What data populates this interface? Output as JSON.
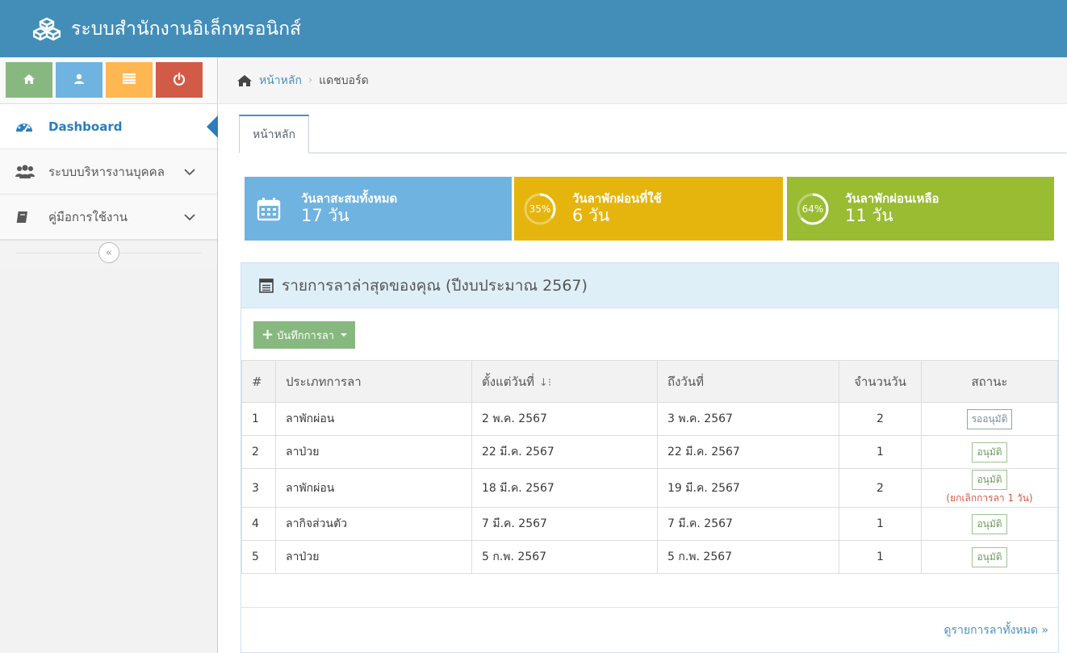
{
  "app": {
    "title": "ระบบสำนักงานอิเล็กทรอนิกส์"
  },
  "colors": {
    "navbar": "#438eb9",
    "accent": "#2b7dbc",
    "blue": "#6fb3e0",
    "orange": "#e5b50d",
    "green": "#9abc32",
    "button_green": "#87b87f",
    "danger": "#d15b47"
  },
  "shortcuts": [
    {
      "icon": "home-icon",
      "color": "#87b87f"
    },
    {
      "icon": "user-icon",
      "color": "#6fb3e0"
    },
    {
      "icon": "list-icon",
      "color": "#ffb752"
    },
    {
      "icon": "power-icon",
      "color": "#d15b47"
    }
  ],
  "sidebar": {
    "items": [
      {
        "label": "Dashboard",
        "icon": "dashboard-icon",
        "active": true
      },
      {
        "label": "ระบบบริหารงานบุคคล",
        "icon": "users-icon"
      },
      {
        "label": "คู่มือการใช้งาน",
        "icon": "book-icon"
      }
    ],
    "collapse_label": "«"
  },
  "breadcrumb": {
    "home": "หน้าหลัก",
    "separator": "›",
    "current": "แดชบอร์ด"
  },
  "tabs": [
    {
      "label": "หน้าหลัก"
    }
  ],
  "infoboxes": [
    {
      "title": "วันลาสะสมทั้งหมด",
      "value": "17 วัน",
      "icon": "calendar-icon"
    },
    {
      "title": "วันลาพักผ่อนที่ใช้",
      "value": "6 วัน",
      "percent_label": "35%",
      "percent": 35
    },
    {
      "title": "วันลาพักผ่อนเหลือ",
      "value": "11 วัน",
      "percent_label": "64%",
      "percent": 64
    }
  ],
  "leave_widget": {
    "title": "รายการลาล่าสุดของคุณ (ปีงบประมาณ 2567)",
    "add_button": "บันทึกการลา",
    "columns": [
      "#",
      "ประเภทการลา",
      "ตั้งแต่วันที่",
      "ถึงวันที่",
      "จำนวนวัน",
      "สถานะ"
    ],
    "rows": [
      {
        "no": "1",
        "type": "ลาพักผ่อน",
        "from": "2 พ.ค. 2567",
        "to": "3 พ.ค. 2567",
        "days": "2",
        "status": "รออนุมัติ",
        "note": ""
      },
      {
        "no": "2",
        "type": "ลาป่วย",
        "from": "22 มี.ค. 2567",
        "to": "22 มี.ค. 2567",
        "days": "1",
        "status": "อนุมัติ",
        "note": ""
      },
      {
        "no": "3",
        "type": "ลาพักผ่อน",
        "from": "18 มี.ค. 2567",
        "to": "19 มี.ค. 2567",
        "days": "2",
        "status": "อนุมัติ",
        "note": "(ยกเลิกการลา 1 วัน)"
      },
      {
        "no": "4",
        "type": "ลากิจส่วนตัว",
        "from": "7 มี.ค. 2567",
        "to": "7 มี.ค. 2567",
        "days": "1",
        "status": "อนุมัติ",
        "note": ""
      },
      {
        "no": "5",
        "type": "ลาป่วย",
        "from": "5 ก.พ. 2567",
        "to": "5 ก.พ. 2567",
        "days": "1",
        "status": "อนุมัติ",
        "note": ""
      }
    ],
    "view_all": "ดูรายการลาทั้งหมด »"
  }
}
